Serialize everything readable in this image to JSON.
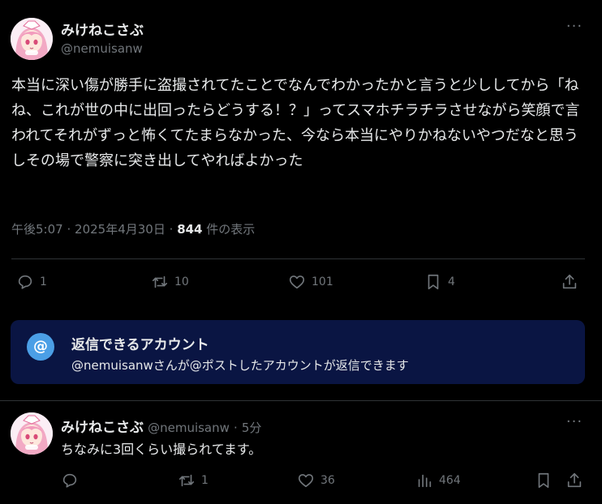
{
  "main_post": {
    "display_name": "みけねこさぶ",
    "handle": "@nemuisanw",
    "text": "本当に深い傷が勝手に盗撮されてたことでなんでわかったかと言うと少ししてから「ねね、これが世の中に出回ったらどうする！？」ってスマホチラチラさせながら笑顔で言われてそれがずっと怖くてたまらなかった、今なら本当にやりかねないやつだなと思うしその場で警察に突き出してやればよかった",
    "time": "午後5:07",
    "date": "2025年4月30日",
    "separator": "·",
    "views_count": "844",
    "views_label": "件の表示",
    "actions": {
      "replies": "1",
      "reposts": "10",
      "likes": "101",
      "bookmarks": "4"
    }
  },
  "reply_restriction": {
    "icon_glyph": "@",
    "title": "返信できるアカウント",
    "description": "@nemuisanwさんが@ポストしたアカウントが返信できます"
  },
  "reply_post": {
    "display_name": "みけねこさぶ",
    "handle": "@nemuisanw",
    "separator": "·",
    "time_ago": "5分",
    "text": "ちなみに3回くらい撮られてます。",
    "actions": {
      "replies": "",
      "reposts": "1",
      "likes": "36",
      "views": "464"
    }
  },
  "colors": {
    "background": "#000000",
    "text_primary": "#e7e9ea",
    "text_secondary": "#71767b",
    "divider": "#2f3336",
    "reply_box_bg": "#0a1543",
    "accent_blue": "#4b9fe6"
  },
  "icons": {
    "more": "more-horizontal-icon",
    "reply": "speech-bubble-icon",
    "repost": "repost-arrows-icon",
    "like": "heart-icon",
    "bookmark": "bookmark-icon",
    "share": "share-upload-icon",
    "views": "bar-chart-icon"
  }
}
